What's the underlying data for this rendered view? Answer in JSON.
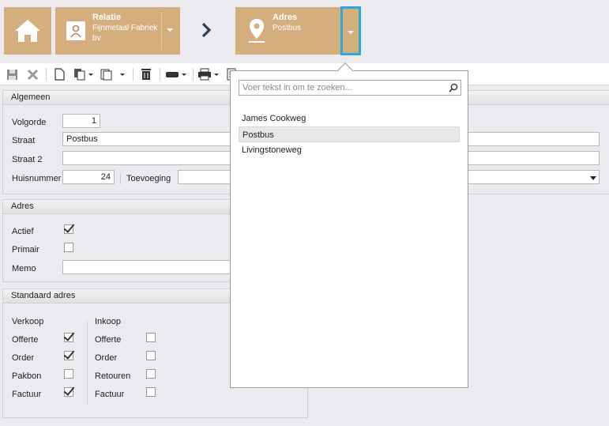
{
  "breadcrumb": {
    "relatie": {
      "title": "Relatie",
      "line1": "Fijnmetaal Fabriek",
      "line2": "bv"
    },
    "adres": {
      "title": "Adres",
      "value": "Postbus"
    }
  },
  "algemeen": {
    "heading": "Algemeen",
    "volgorde_label": "Volgorde",
    "volgorde_value": "1",
    "straat_label": "Straat",
    "straat_value": "Postbus",
    "straat2_label": "Straat 2",
    "straat2_value": "",
    "huisnummer_label": "Huisnummer",
    "huisnummer_value": "24",
    "toevoeging_label": "Toevoeging",
    "toevoeging_value": ""
  },
  "adres": {
    "heading": "Adres",
    "actief_label": "Actief",
    "actief": true,
    "primair_label": "Primair",
    "primair": false,
    "memo_label": "Memo",
    "memo_value": ""
  },
  "standaard": {
    "heading": "Standaard adres",
    "verkoop": {
      "heading": "Verkoop",
      "items": [
        {
          "label": "Offerte",
          "checked": true
        },
        {
          "label": "Order",
          "checked": true
        },
        {
          "label": "Pakbon",
          "checked": false
        },
        {
          "label": "Factuur",
          "checked": true
        }
      ]
    },
    "inkoop": {
      "heading": "Inkoop",
      "items": [
        {
          "label": "Offerte",
          "checked": false
        },
        {
          "label": "Order",
          "checked": false
        },
        {
          "label": "Retouren",
          "checked": false
        },
        {
          "label": "Factuur",
          "checked": false
        }
      ]
    }
  },
  "dropdown": {
    "search_placeholder": "Voer tekst in om te zoeken...",
    "options": [
      "James Cookweg",
      "Postbus",
      "Livingstoneweg"
    ],
    "selected": "Postbus"
  },
  "colors": {
    "tile": "#d5ae7e",
    "focus": "#29a9e0",
    "chevron": "#2c3e55"
  }
}
